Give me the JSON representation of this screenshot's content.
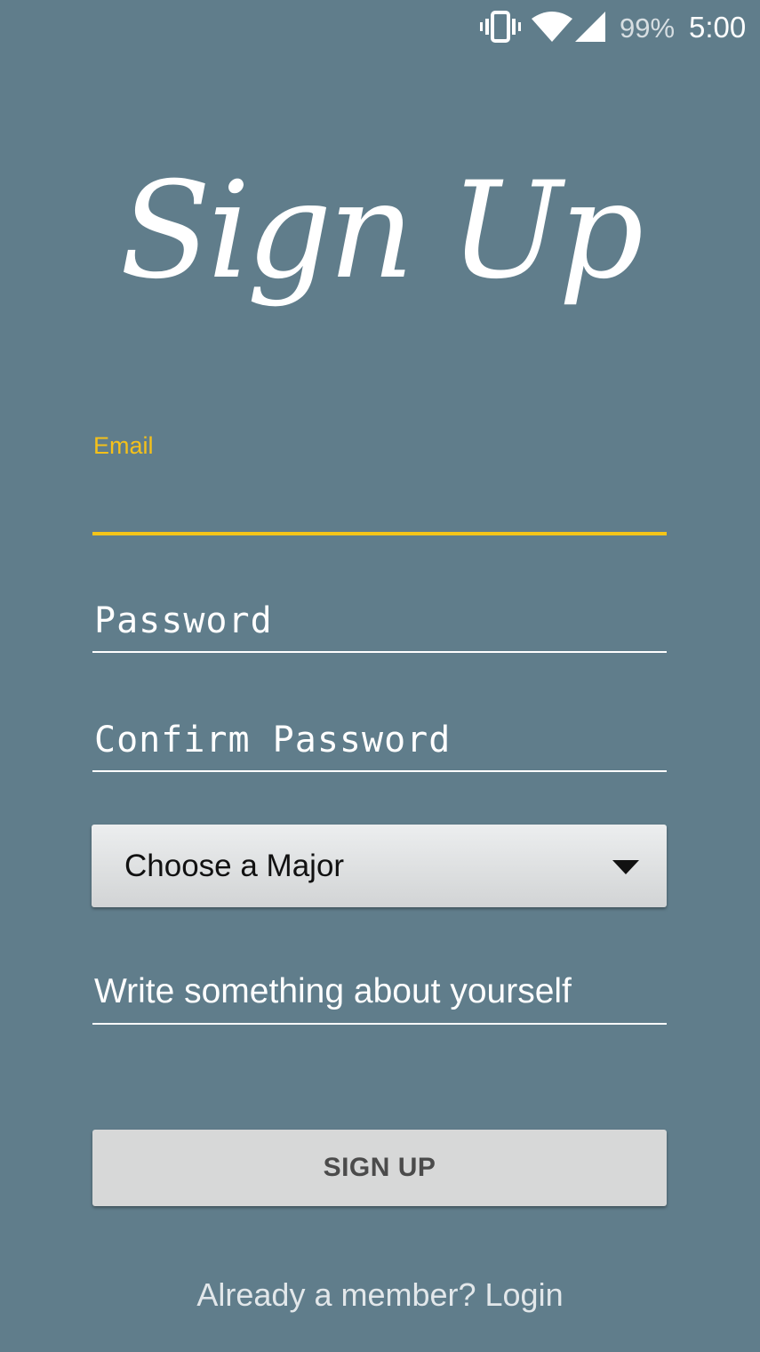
{
  "status_bar": {
    "battery": "99%",
    "time": "5:00",
    "icons": [
      "vibrate-icon",
      "wifi-icon",
      "signal-icon"
    ]
  },
  "title": "Sign Up",
  "form": {
    "email_label": "Email",
    "email_value": "",
    "password_placeholder": "Password",
    "confirm_password_placeholder": "Confirm Password",
    "major_select": "Choose a Major",
    "about_placeholder": "Write something about yourself",
    "signup_label": "SIGN UP",
    "login_link": "Already a member? Login"
  },
  "colors": {
    "background": "#607d8b",
    "accent": "#f5c518",
    "text": "#ffffff",
    "button": "#d7d8d8"
  }
}
